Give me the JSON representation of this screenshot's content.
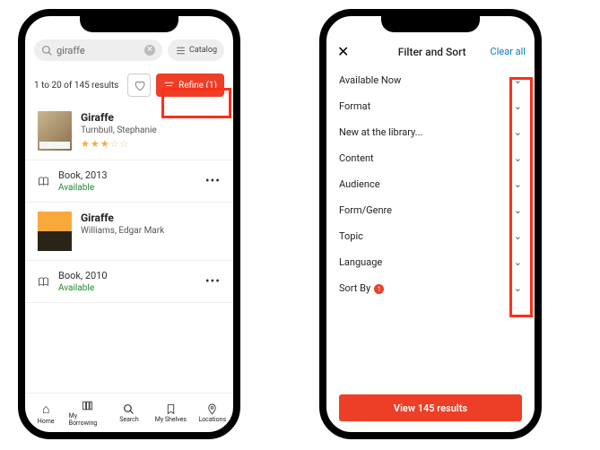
{
  "left": {
    "search": {
      "query": "giraffe",
      "catalog_label": "Catalog"
    },
    "results_summary": "1 to 20 of 145 results",
    "refine_label": "Refine (1)",
    "items": [
      {
        "title": "Giraffe",
        "author": "Turnbull, Stephanie",
        "rating": 3,
        "format_year": "Book, 2013",
        "availability": "Available"
      },
      {
        "title": "Giraffe",
        "author": "Williams, Edgar Mark",
        "rating": 0,
        "format_year": "Book, 2010",
        "availability": "Available"
      }
    ],
    "tabs": [
      {
        "label": "Home"
      },
      {
        "label": "My Borrowing"
      },
      {
        "label": "Search"
      },
      {
        "label": "My Shelves"
      },
      {
        "label": "Locations"
      }
    ]
  },
  "right": {
    "header_title": "Filter and Sort",
    "clear_all_label": "Clear all",
    "filters": [
      {
        "label": "Available Now"
      },
      {
        "label": "Format"
      },
      {
        "label": "New at the library..."
      },
      {
        "label": "Content"
      },
      {
        "label": "Audience"
      },
      {
        "label": "Form/Genre"
      },
      {
        "label": "Topic"
      },
      {
        "label": "Language"
      },
      {
        "label": "Sort By",
        "badge": "1"
      }
    ],
    "view_results_label": "View 145 results"
  },
  "colors": {
    "accent": "#ed3f27",
    "link": "#0a7bc4",
    "available": "#1c8a2e"
  }
}
